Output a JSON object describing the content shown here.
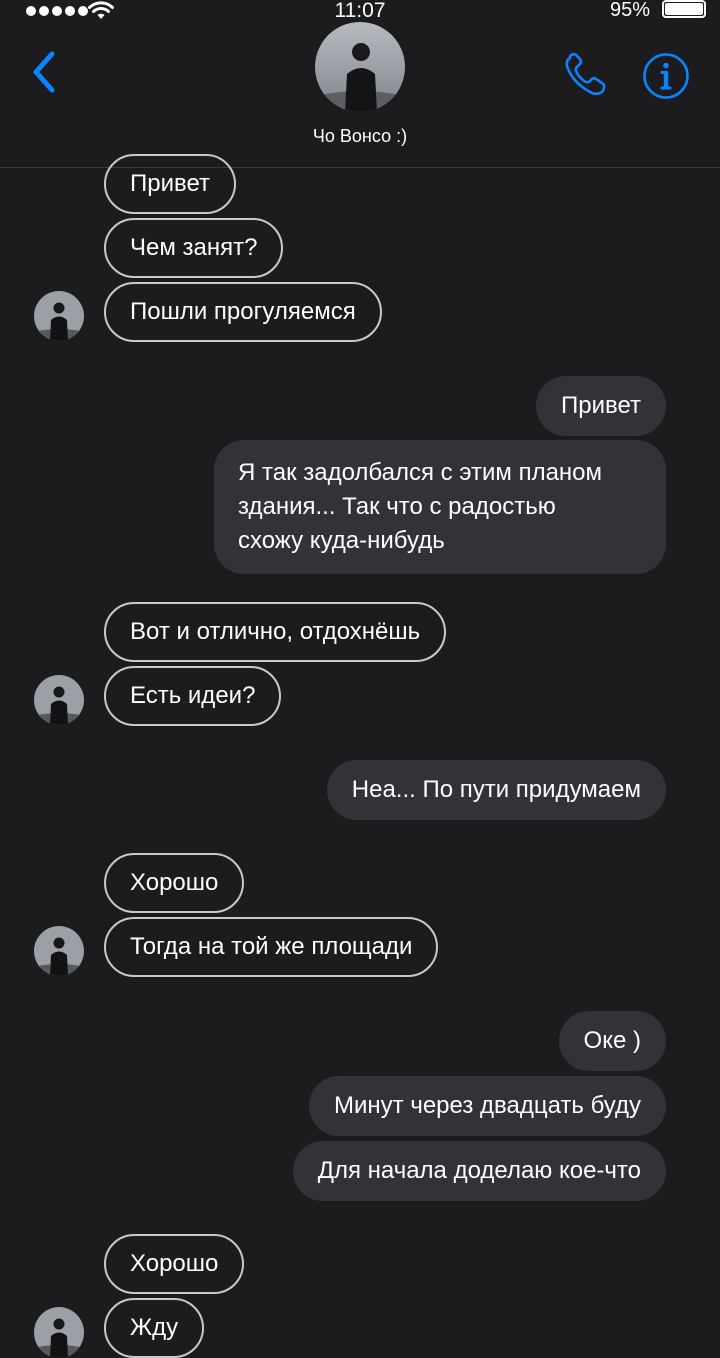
{
  "status_bar": {
    "time": "11:07",
    "battery_percent": "95%",
    "signal_bars": 5
  },
  "header": {
    "contact_name": "Чо Вонсо  :)"
  },
  "colors": {
    "accent": "#0a84ff",
    "background": "#1c1b1e",
    "outgoing_bubble": "#333238",
    "incoming_border": "#c9c9cc"
  },
  "messages": [
    {
      "direction": "in",
      "text": "Привет"
    },
    {
      "direction": "in",
      "text": "Чем занят?"
    },
    {
      "direction": "in",
      "text": "Пошли прогуляемся"
    },
    {
      "direction": "out",
      "text": "Привет"
    },
    {
      "direction": "out",
      "lines": [
        "Я так задолбался с этим планом",
        "здания... Так что с радостью",
        "схожу куда-нибудь"
      ]
    },
    {
      "direction": "in",
      "text": "Вот и отлично, отдохнёшь"
    },
    {
      "direction": "in",
      "text": "Есть идеи?"
    },
    {
      "direction": "out",
      "text": "Неа... По пути придумаем"
    },
    {
      "direction": "in",
      "text": "Хорошо"
    },
    {
      "direction": "in",
      "text": "Тогда на той же площади"
    },
    {
      "direction": "out",
      "text": "Оке )"
    },
    {
      "direction": "out",
      "text": "Минут через двадцать буду"
    },
    {
      "direction": "out",
      "text": "Для начала доделаю кое-что"
    },
    {
      "direction": "in",
      "text": "Хорошо"
    },
    {
      "direction": "in",
      "text": "Жду"
    }
  ]
}
